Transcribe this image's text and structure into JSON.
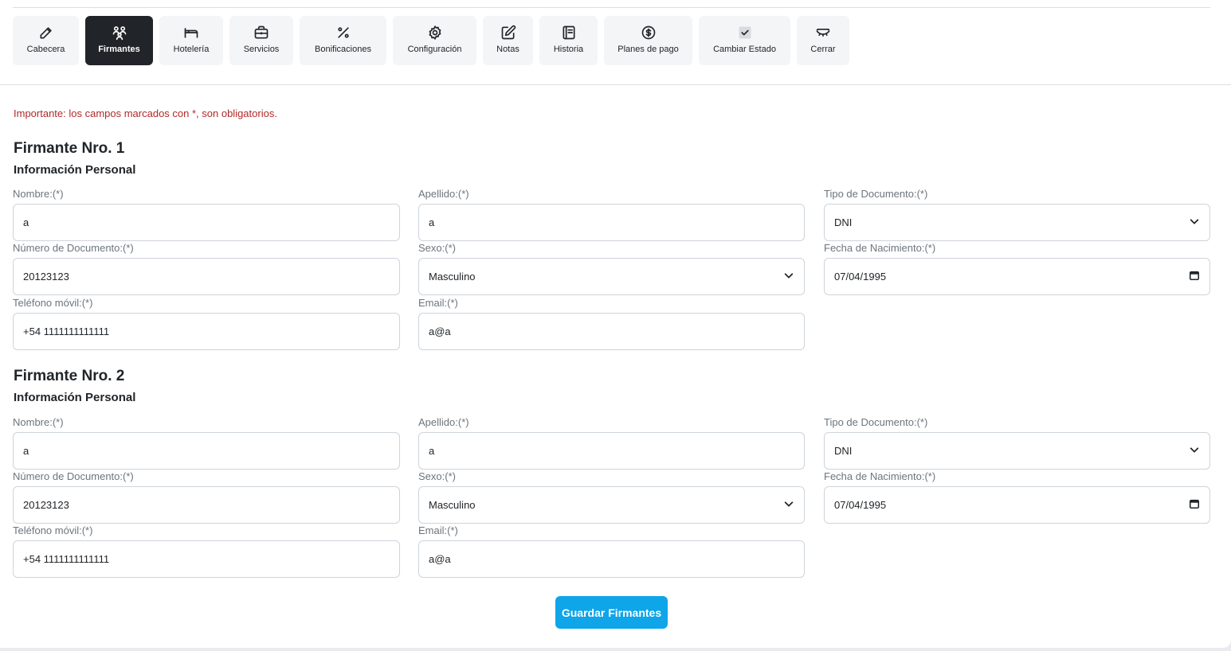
{
  "toolbar": [
    {
      "id": "cabecera",
      "label": "Cabecera",
      "icon": "pencil-icon",
      "width": 83,
      "active": false
    },
    {
      "id": "firmantes",
      "label": "Firmantes",
      "icon": "users-icon",
      "width": 85,
      "active": true
    },
    {
      "id": "hoteleria",
      "label": "Hotelería",
      "icon": "bed-icon",
      "width": 80,
      "active": false
    },
    {
      "id": "servicios",
      "label": "Servicios",
      "icon": "briefcase-icon",
      "width": 80,
      "active": false
    },
    {
      "id": "bonificaciones",
      "label": "Bonificaciones",
      "icon": "percent-icon",
      "width": 109,
      "active": false
    },
    {
      "id": "configuracion",
      "label": "Configuración",
      "icon": "gear-icon",
      "width": 105,
      "active": false
    },
    {
      "id": "notas",
      "label": "Notas",
      "icon": "note-edit-icon",
      "width": 63,
      "active": false
    },
    {
      "id": "historia",
      "label": "Historia",
      "icon": "document-icon",
      "width": 73,
      "active": false
    },
    {
      "id": "planes",
      "label": "Planes de pago",
      "icon": "dollar-circle-icon",
      "width": 111,
      "active": false
    },
    {
      "id": "cambiar",
      "label": "Cambiar Estado",
      "icon": "checkbox-icon",
      "width": 115,
      "active": false
    },
    {
      "id": "cerrar",
      "label": "Cerrar",
      "icon": "closed-eye-icon",
      "width": 66,
      "active": false
    }
  ],
  "notice": "Importante: los campos marcados con *, son obligatorios.",
  "firmantes": [
    {
      "title": "Firmante Nro. 1",
      "subtitle": "Información Personal",
      "fields": {
        "nombre": {
          "label": "Nombre:(*)",
          "value": "a"
        },
        "apellido": {
          "label": "Apellido:(*)",
          "value": "a"
        },
        "tipo_doc": {
          "label": "Tipo de Documento:(*)",
          "value": "DNI"
        },
        "num_doc": {
          "label": "Número de Documento:(*)",
          "value": "20123123"
        },
        "sexo": {
          "label": "Sexo:(*)",
          "value": "Masculino"
        },
        "fecha_nac": {
          "label": "Fecha de Nacimiento:(*)",
          "value": "07/04/1995"
        },
        "telefono": {
          "label": "Teléfono móvil:(*)",
          "value": "+54 1111111111111"
        },
        "email": {
          "label": "Email:(*)",
          "value": "a@a"
        }
      }
    },
    {
      "title": "Firmante Nro. 2",
      "subtitle": "Información Personal",
      "fields": {
        "nombre": {
          "label": "Nombre:(*)",
          "value": "a"
        },
        "apellido": {
          "label": "Apellido:(*)",
          "value": "a"
        },
        "tipo_doc": {
          "label": "Tipo de Documento:(*)",
          "value": "DNI"
        },
        "num_doc": {
          "label": "Número de Documento:(*)",
          "value": "20123123"
        },
        "sexo": {
          "label": "Sexo:(*)",
          "value": "Masculino"
        },
        "fecha_nac": {
          "label": "Fecha de Nacimiento:(*)",
          "value": "07/04/1995"
        },
        "telefono": {
          "label": "Teléfono móvil:(*)",
          "value": "+54 1111111111111"
        },
        "email": {
          "label": "Email:(*)",
          "value": "a@a"
        }
      }
    }
  ],
  "save_button": "Guardar Firmantes",
  "colors": {
    "accent": "#0ea5e9",
    "active_tab": "#212529",
    "notice": "#b02a2a"
  }
}
